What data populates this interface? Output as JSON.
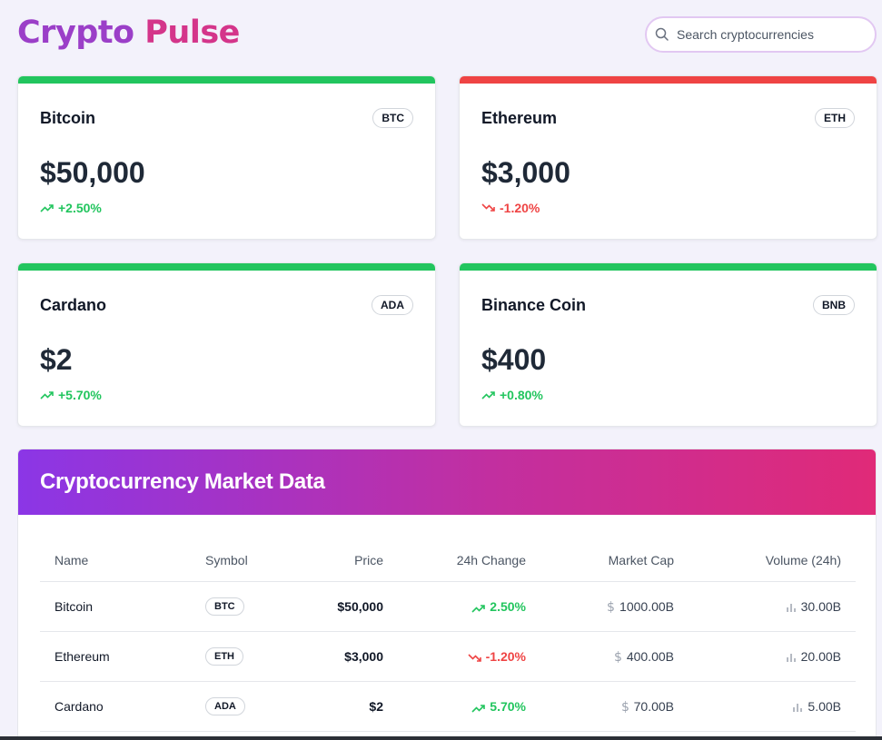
{
  "app": {
    "title_part1": "Crypto",
    "title_part2": "Pulse"
  },
  "search": {
    "placeholder": "Search cryptocurrencies",
    "value": ""
  },
  "colors": {
    "up": "#22c55e",
    "down": "#ef4444",
    "brand_purple": "#9b3fc8",
    "brand_pink": "#d4358a"
  },
  "cards": [
    {
      "name": "Bitcoin",
      "symbol": "BTC",
      "price": "$50,000",
      "change": "+2.50%",
      "direction": "up"
    },
    {
      "name": "Ethereum",
      "symbol": "ETH",
      "price": "$3,000",
      "change": "-1.20%",
      "direction": "down"
    },
    {
      "name": "Cardano",
      "symbol": "ADA",
      "price": "$2",
      "change": "+5.70%",
      "direction": "up"
    },
    {
      "name": "Binance Coin",
      "symbol": "BNB",
      "price": "$400",
      "change": "+0.80%",
      "direction": "up"
    }
  ],
  "market": {
    "title": "Cryptocurrency Market Data",
    "columns": [
      "Name",
      "Symbol",
      "Price",
      "24h Change",
      "Market Cap",
      "Volume (24h)"
    ],
    "rows": [
      {
        "name": "Bitcoin",
        "symbol": "BTC",
        "price": "$50,000",
        "change": "2.50%",
        "direction": "up",
        "market_cap": "1000.00B",
        "volume": "30.00B"
      },
      {
        "name": "Ethereum",
        "symbol": "ETH",
        "price": "$3,000",
        "change": "-1.20%",
        "direction": "down",
        "market_cap": "400.00B",
        "volume": "20.00B"
      },
      {
        "name": "Cardano",
        "symbol": "ADA",
        "price": "$2",
        "change": "5.70%",
        "direction": "up",
        "market_cap": "70.00B",
        "volume": "5.00B"
      }
    ]
  },
  "icons": {
    "search": "search-icon",
    "trend_up": "trending-up-icon",
    "trend_down": "trending-down-icon",
    "dollar": "dollar-icon",
    "volume": "bar-chart-icon"
  }
}
